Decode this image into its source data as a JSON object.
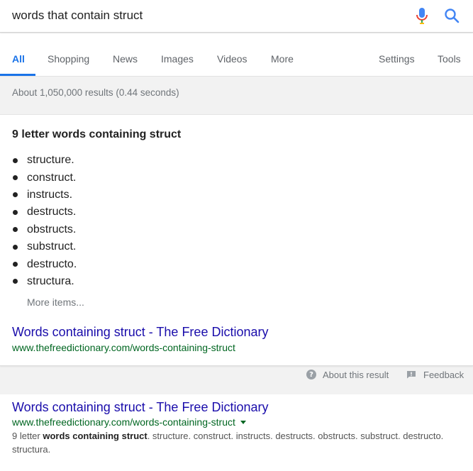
{
  "search": {
    "query": "words that contain struct",
    "mic_icon": "mic-icon",
    "search_icon": "search-icon"
  },
  "tabs": {
    "items": [
      {
        "label": "All",
        "active": true
      },
      {
        "label": "Shopping"
      },
      {
        "label": "News"
      },
      {
        "label": "Images"
      },
      {
        "label": "Videos"
      },
      {
        "label": "More"
      }
    ],
    "settings": "Settings",
    "tools": "Tools"
  },
  "stats": "About 1,050,000 results (0.44 seconds)",
  "featured_snippet": {
    "heading": "9 letter words containing struct",
    "words": [
      "structure.",
      "construct.",
      "instructs.",
      "destructs.",
      "obstructs.",
      "substruct.",
      "destructo.",
      "structura."
    ],
    "more_items": "More items...",
    "title": "Words containing struct - The Free Dictionary",
    "url": "www.thefreedictionary.com/words-containing-struct"
  },
  "about_row": {
    "about_label": "About this result",
    "feedback_label": "Feedback"
  },
  "result": {
    "title": "Words containing struct - The Free Dictionary",
    "url": "www.thefreedictionary.com/words-containing-struct",
    "snippet_prefix": "9 letter ",
    "snippet_bold": "words containing struct",
    "snippet_rest": ". structure. construct. instructs. destructs. obstructs. substruct. destructo. structura."
  },
  "colors": {
    "link": "#1a0dab",
    "url": "#006621",
    "active_tab": "#1a73e8"
  }
}
